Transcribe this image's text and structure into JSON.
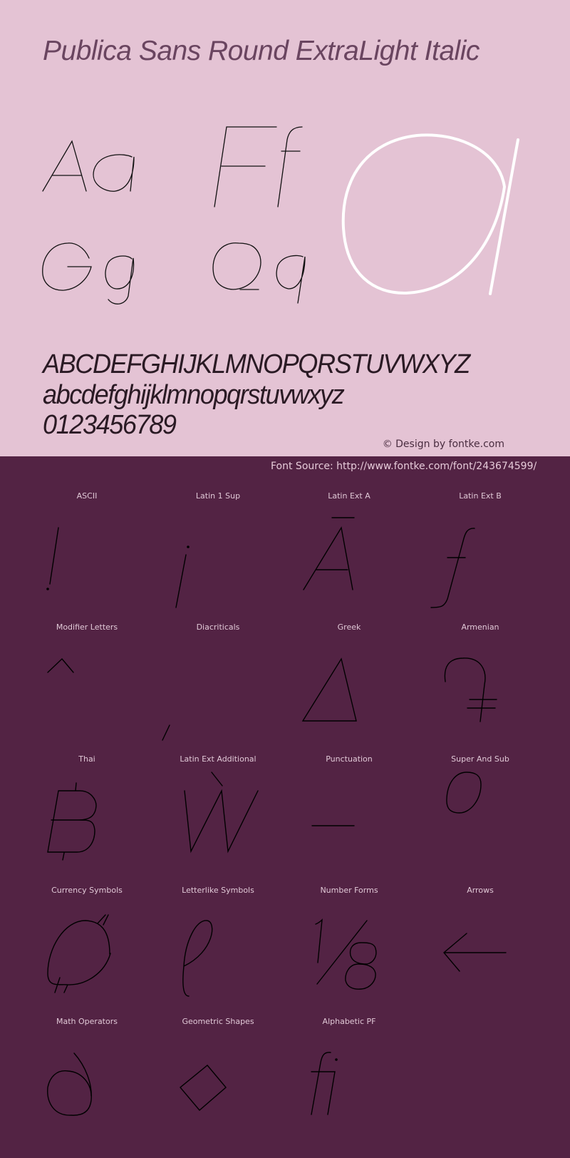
{
  "header": {
    "font_name": "Publica Sans Round ExtraLight Italic"
  },
  "specimen": {
    "pairs": [
      "Aa",
      "Ff",
      "Gg",
      "Qq"
    ],
    "hero_glyph": "a",
    "uppercase": "ABCDEFGHIJKLMNOPQRSTUVWXYZ",
    "lowercase": "abcdefghijklmnopqrstuvwxyz",
    "digits": "0123456789"
  },
  "credit": "© Design by fontke.com",
  "source": "Font Source: http://www.fontke.com/font/243674599/",
  "colors": {
    "top_background": "#e4c3d4",
    "bottom_background": "#532344",
    "hero_glyph": "#ffffff",
    "glyph_stroke": "#000000"
  },
  "blocks": [
    {
      "label": "ASCII",
      "glyph": "!"
    },
    {
      "label": "Latin 1 Sup",
      "glyph": "¡"
    },
    {
      "label": "Latin Ext A",
      "glyph": "Ā"
    },
    {
      "label": "Latin Ext B",
      "glyph": "ƒ"
    },
    {
      "label": "Modifier Letters",
      "glyph": "ˆ"
    },
    {
      "label": "Diacriticals",
      "glyph": "̗"
    },
    {
      "label": "Greek",
      "glyph": "Δ"
    },
    {
      "label": "Armenian",
      "glyph": "֏"
    },
    {
      "label": "Thai",
      "glyph": "฿"
    },
    {
      "label": "Latin Ext Additional",
      "glyph": "Ẁ"
    },
    {
      "label": "Punctuation",
      "glyph": "‒"
    },
    {
      "label": "Super And Sub",
      "glyph": "⁰"
    },
    {
      "label": "Currency Symbols",
      "glyph": "₵"
    },
    {
      "label": "Letterlike Symbols",
      "glyph": "ℓ"
    },
    {
      "label": "Number Forms",
      "glyph": "⅛"
    },
    {
      "label": "Arrows",
      "glyph": "←"
    },
    {
      "label": "Math Operators",
      "glyph": "∂"
    },
    {
      "label": "Geometric Shapes",
      "glyph": "◊"
    },
    {
      "label": "Alphabetic PF",
      "glyph": "ﬁ"
    }
  ]
}
